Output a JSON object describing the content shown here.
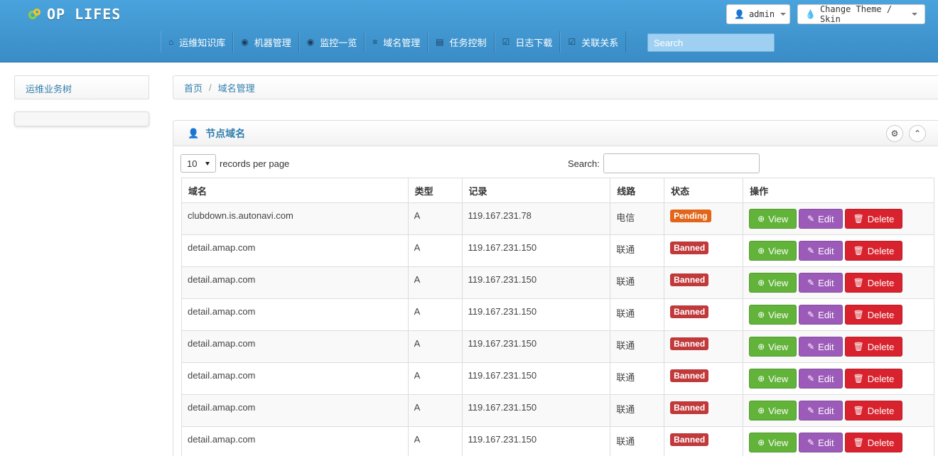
{
  "brand": {
    "name": "OP LIFES"
  },
  "top_buttons": {
    "user_label": "admin",
    "theme_label": "Change Theme / Skin"
  },
  "nav": {
    "items": [
      {
        "label": "运维知识库",
        "icon": "home-icon",
        "glyph": "⌂"
      },
      {
        "label": "机器管理",
        "icon": "eye-icon",
        "glyph": "◉"
      },
      {
        "label": "监控一览",
        "icon": "eye-icon",
        "glyph": "◉"
      },
      {
        "label": "域名管理",
        "icon": "list-icon",
        "glyph": "≡"
      },
      {
        "label": "任务控制",
        "icon": "list-alt-icon",
        "glyph": "▤"
      },
      {
        "label": "日志下载",
        "icon": "check-icon",
        "glyph": "☑"
      },
      {
        "label": "关联关系",
        "icon": "check-icon",
        "glyph": "☑"
      }
    ],
    "search_placeholder": "Search"
  },
  "sidebar": {
    "tree_title": "运维业务树"
  },
  "breadcrumb": {
    "home": "首页",
    "current": "域名管理"
  },
  "panel": {
    "title": "节点域名",
    "records_per_page_value": "10",
    "records_per_page_label": "records per page",
    "search_label": "Search:",
    "columns": [
      "域名",
      "类型",
      "记录",
      "线路",
      "状态",
      "操作"
    ],
    "buttons": {
      "view": "View",
      "edit": "Edit",
      "delete": "Delete"
    },
    "rows": [
      {
        "domain": "clubdown.is.autonavi.com",
        "type": "A",
        "record": "119.167.231.78",
        "line": "电信",
        "status": "Pending",
        "status_kind": "pending"
      },
      {
        "domain": "detail.amap.com",
        "type": "A",
        "record": "119.167.231.150",
        "line": "联通",
        "status": "Banned",
        "status_kind": "banned"
      },
      {
        "domain": "detail.amap.com",
        "type": "A",
        "record": "119.167.231.150",
        "line": "联通",
        "status": "Banned",
        "status_kind": "banned"
      },
      {
        "domain": "detail.amap.com",
        "type": "A",
        "record": "119.167.231.150",
        "line": "联通",
        "status": "Banned",
        "status_kind": "banned"
      },
      {
        "domain": "detail.amap.com",
        "type": "A",
        "record": "119.167.231.150",
        "line": "联通",
        "status": "Banned",
        "status_kind": "banned"
      },
      {
        "domain": "detail.amap.com",
        "type": "A",
        "record": "119.167.231.150",
        "line": "联通",
        "status": "Banned",
        "status_kind": "banned"
      },
      {
        "domain": "detail.amap.com",
        "type": "A",
        "record": "119.167.231.150",
        "line": "联通",
        "status": "Banned",
        "status_kind": "banned"
      },
      {
        "domain": "detail.amap.com",
        "type": "A",
        "record": "119.167.231.150",
        "line": "联通",
        "status": "Banned",
        "status_kind": "banned"
      }
    ]
  },
  "colors": {
    "topbar": "#3a8cc6",
    "link": "#317eac",
    "view": "#62b33a",
    "edit": "#9c5bb8",
    "delete": "#d8222d",
    "pending": "#e1661a",
    "banned": "#c0393b"
  }
}
